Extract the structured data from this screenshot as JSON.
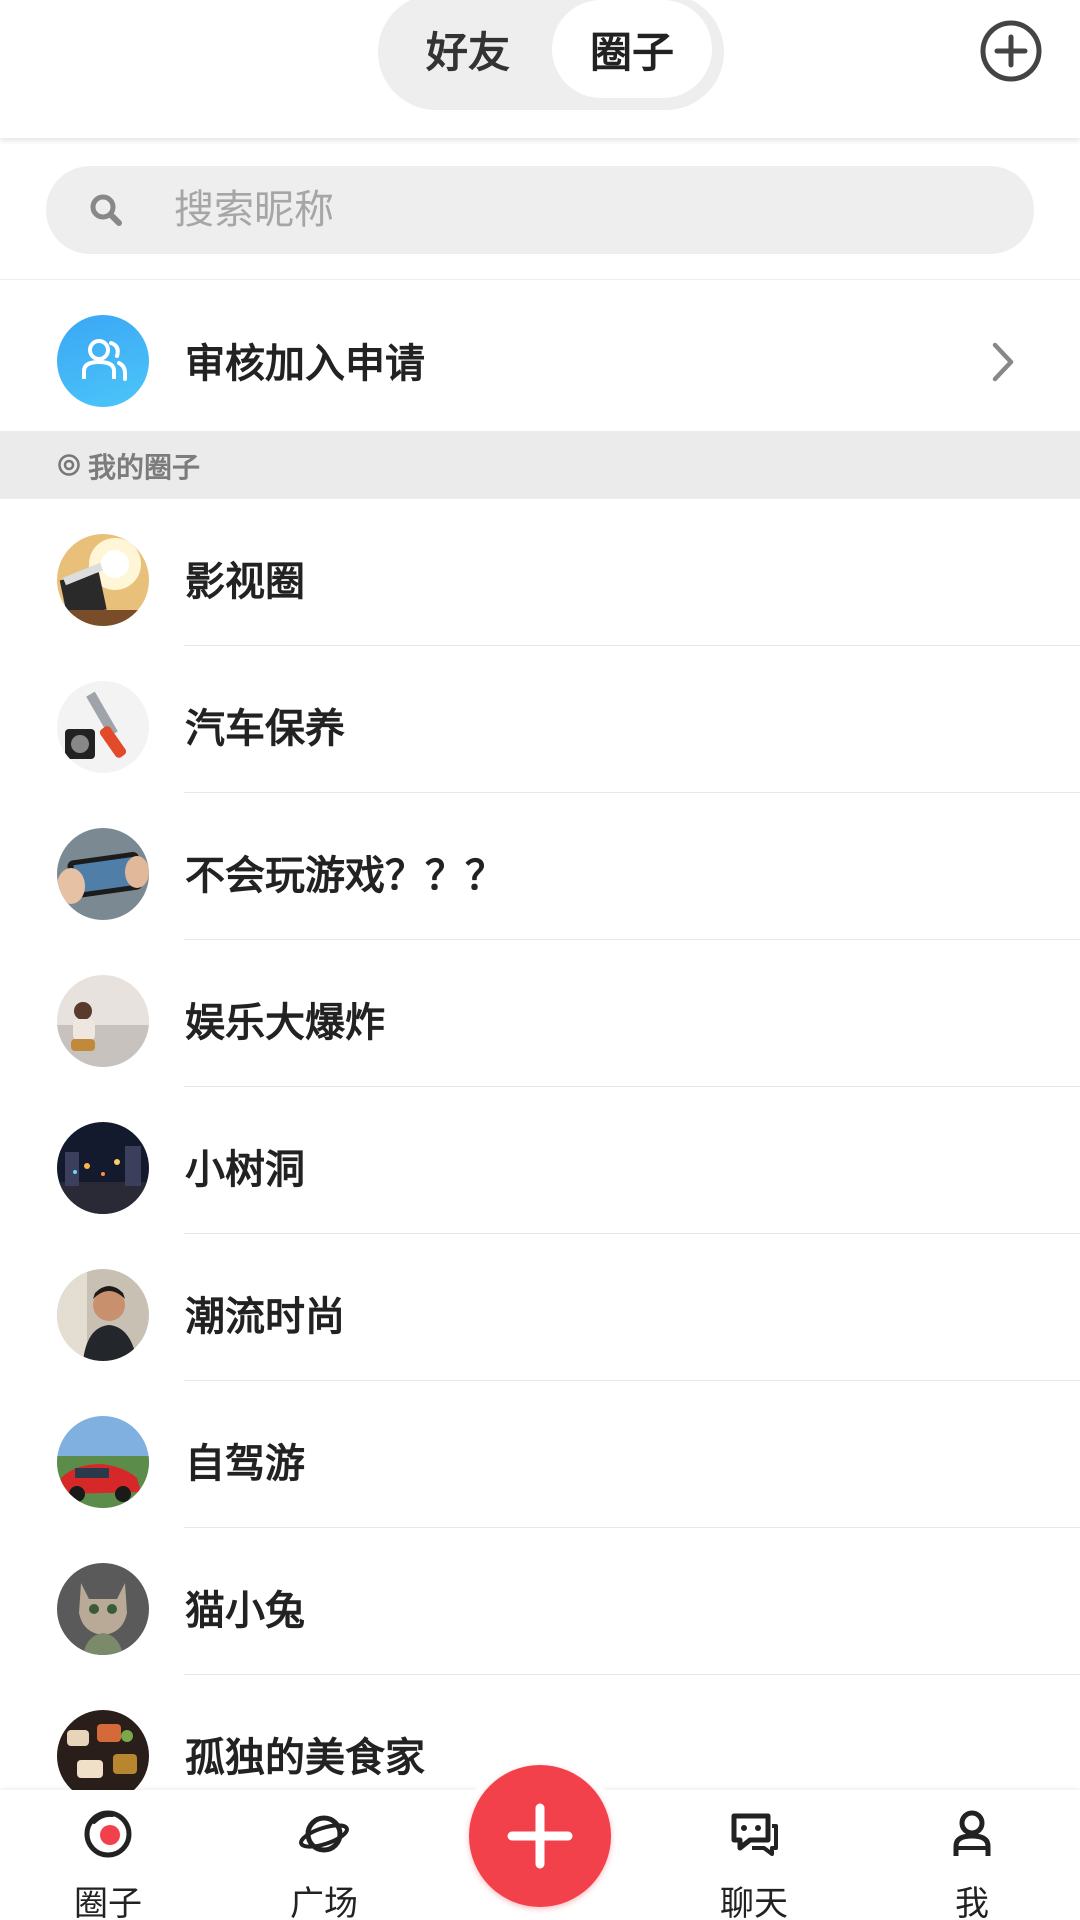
{
  "header": {
    "tabs": [
      {
        "label": "好友",
        "active": false
      },
      {
        "label": "圈子",
        "active": true
      }
    ],
    "add_icon": "plus-circle-icon"
  },
  "search": {
    "placeholder": "搜索昵称",
    "icon": "search-icon"
  },
  "review": {
    "label": "审核加入申请",
    "icon": "users-icon",
    "accent_color": "#3aa6f5"
  },
  "section": {
    "label": "我的圈子",
    "icon": "circle-target-icon"
  },
  "circles": [
    {
      "name": "影视圈",
      "avatar": "clapperboard-sun"
    },
    {
      "name": "汽车保养",
      "avatar": "tools"
    },
    {
      "name": "不会玩游戏？？？",
      "avatar": "phone-game"
    },
    {
      "name": "娱乐大爆炸",
      "avatar": "girl-road"
    },
    {
      "name": "小树洞",
      "avatar": "night-street"
    },
    {
      "name": "潮流时尚",
      "avatar": "man-portrait"
    },
    {
      "name": "自驾游",
      "avatar": "red-car"
    },
    {
      "name": "猫小兔",
      "avatar": "cat"
    },
    {
      "name": "孤独的美食家",
      "avatar": "food"
    }
  ],
  "bottom_nav": {
    "items": [
      {
        "label": "圈子",
        "icon": "circle-target-icon"
      },
      {
        "label": "广场",
        "icon": "planet-icon"
      },
      {
        "label": "聊天",
        "icon": "chat-icon"
      },
      {
        "label": "我",
        "icon": "person-icon"
      }
    ],
    "fab_icon": "plus-icon",
    "fab_color": "#f2414b"
  }
}
